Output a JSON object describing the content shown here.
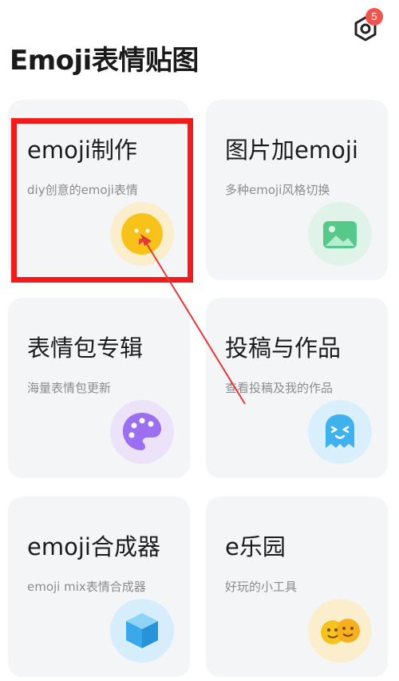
{
  "header": {
    "title": "Emoji表情贴图",
    "notification_count": "5"
  },
  "cards": [
    {
      "title": "emoji制作",
      "subtitle": "diy创意的emoji表情",
      "icon": "smiley-face-icon",
      "color": "#f7c31a"
    },
    {
      "title": "图片加emoji",
      "subtitle": "多种emoji风格切换",
      "icon": "image-icon",
      "color": "#56c98a"
    },
    {
      "title": "表情包专辑",
      "subtitle": "海量表情包更新",
      "icon": "palette-icon",
      "color": "#9b6ff0"
    },
    {
      "title": "投稿与作品",
      "subtitle": "查看投稿及我的作品",
      "icon": "ghost-face-icon",
      "color": "#3fb1ec"
    },
    {
      "title": "emoji合成器",
      "subtitle": "emoji mix表情合成器",
      "icon": "cube-icon",
      "color": "#3aa8ea"
    },
    {
      "title": "e乐园",
      "subtitle": "好玩的小工具",
      "icon": "double-smiley-icon",
      "color": "#f6c21e"
    }
  ],
  "annotation": {
    "highlight_color": "#f01c1c",
    "arrow_color": "#e03a3a"
  }
}
